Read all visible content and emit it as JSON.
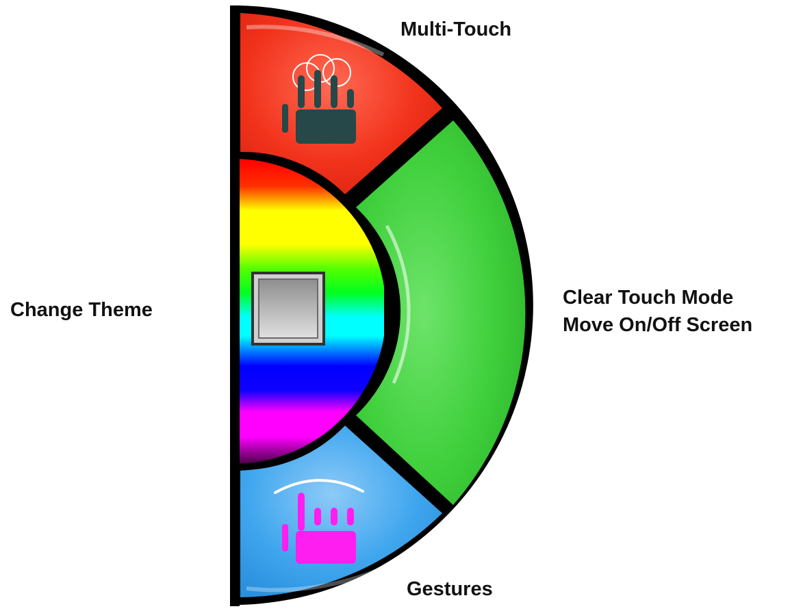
{
  "menu": {
    "top_label": "Multi-Touch",
    "left_label": "Change Theme",
    "right_label_line1": "Clear Touch Mode",
    "right_label_line2": "Move On/Off Screen",
    "bottom_label": "Gestures"
  },
  "colors": {
    "multitouch_segment": "#f2331c",
    "clear_segment": "#3fcf3c",
    "gestures_segment": "#3fa6ee",
    "outline": "#000000",
    "multitouch_icon": "#264848",
    "gestures_icon": "#ff1ef0",
    "theme_button": "#a8a8a8"
  },
  "icons": {
    "multitouch": "multi-touch-hand-icon",
    "gestures": "gesture-hand-icon",
    "theme": "rainbow-theme-icon",
    "center": "square-button-icon"
  }
}
